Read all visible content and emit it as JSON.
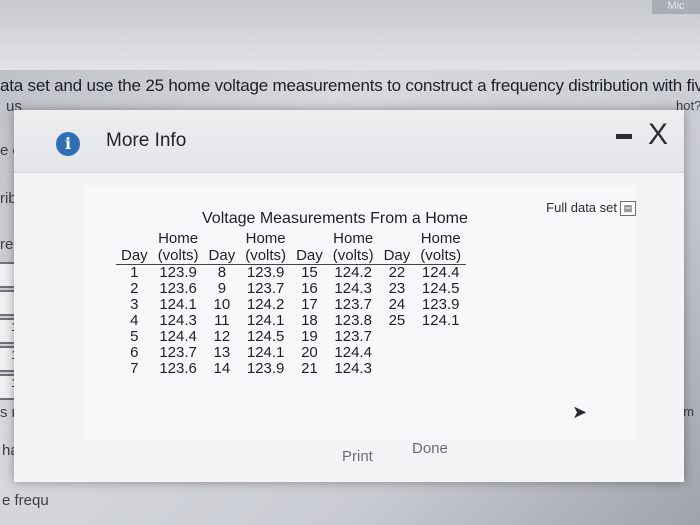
{
  "page": {
    "corner_tab": "Mic",
    "instruction": "ata set and use the 25 home voltage measurements to construct a frequency distribution with five cla",
    "side_fragments": [
      "us",
      "e c",
      "ribu",
      "requ",
      "s roun",
      "have",
      "e frequ"
    ],
    "right_fragments": [
      "hot?",
      "the m"
    ],
    "side_box_values": [
      "",
      "",
      "1",
      "1",
      "1"
    ]
  },
  "modal": {
    "title": "More Info",
    "info_icon": "i",
    "minimize_icon": "minimize-icon",
    "close_icon": "X",
    "full_data_set_label": "Full data set",
    "table_title": "Voltage Measurements From a Home",
    "header_top": [
      "",
      "Home",
      "",
      "Home",
      "",
      "Home",
      "",
      "Home"
    ],
    "header_bottom": [
      "Day",
      "(volts)",
      "Day",
      "(volts)",
      "Day",
      "(volts)",
      "Day",
      "(volts)"
    ],
    "rows": [
      [
        "1",
        "123.9",
        "8",
        "123.9",
        "15",
        "124.2",
        "22",
        "124.4"
      ],
      [
        "2",
        "123.6",
        "9",
        "123.7",
        "16",
        "124.3",
        "23",
        "124.5"
      ],
      [
        "3",
        "124.1",
        "10",
        "124.2",
        "17",
        "123.7",
        "24",
        "123.9"
      ],
      [
        "4",
        "124.3",
        "11",
        "124.1",
        "18",
        "123.8",
        "25",
        "124.1"
      ],
      [
        "5",
        "124.4",
        "12",
        "124.5",
        "19",
        "123.7",
        "",
        ""
      ],
      [
        "6",
        "123.7",
        "13",
        "124.1",
        "20",
        "124.4",
        "",
        ""
      ],
      [
        "7",
        "123.6",
        "14",
        "123.9",
        "21",
        "124.3",
        "",
        ""
      ]
    ],
    "print_label": "Print",
    "done_label": "Done"
  }
}
